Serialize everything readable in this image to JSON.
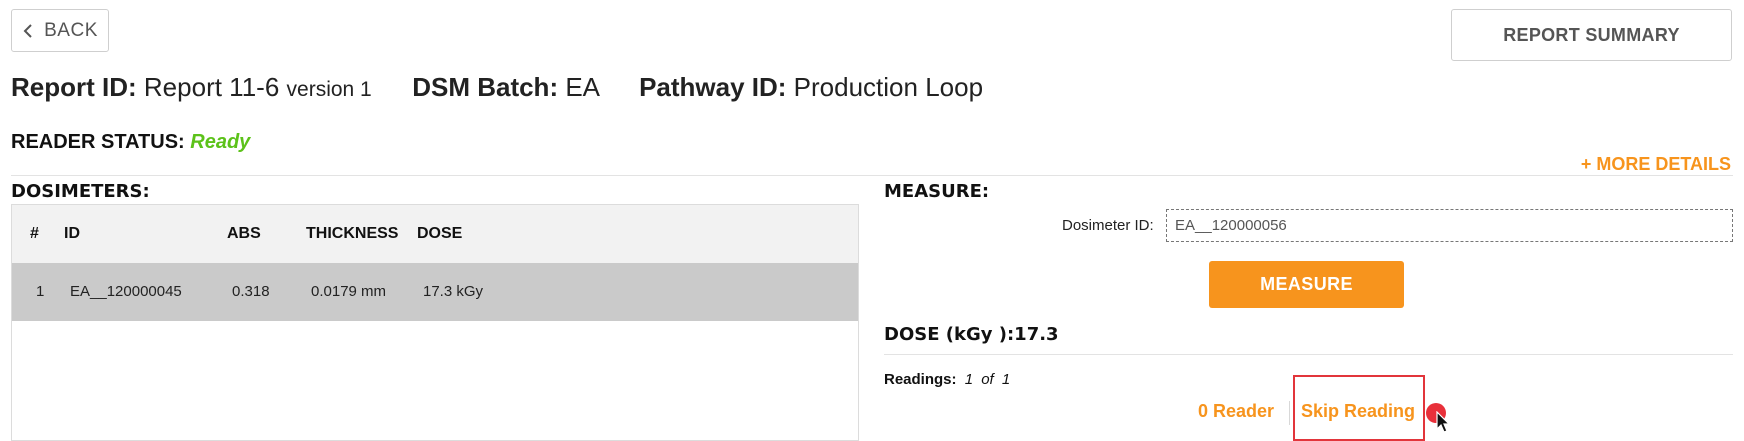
{
  "header": {
    "back_label": "BACK",
    "summary_label": "REPORT SUMMARY"
  },
  "report": {
    "report_id_label": "Report ID:",
    "report_id_value": "Report 11-6",
    "report_version": "version 1",
    "batch_label": "DSM Batch:",
    "batch_value": "EA",
    "pathway_label": "Pathway ID:",
    "pathway_value": "Production Loop"
  },
  "status": {
    "label": "READER STATUS:",
    "value": "Ready",
    "value_color": "#5cc21a"
  },
  "more_details": "+ MORE DETAILS",
  "dosimeters": {
    "title": "DOSIMETERS:",
    "columns": [
      "#",
      "ID",
      "ABS",
      "THICKNESS",
      "DOSE"
    ],
    "rows": [
      {
        "num": "1",
        "id": "EA__120000045",
        "abs": "0.318",
        "thickness": "0.0179 mm",
        "dose": "17.3 kGy"
      }
    ]
  },
  "measure": {
    "title": "MEASURE:",
    "dosimeter_id_label": "Dosimeter ID:",
    "dosimeter_id_value": "EA__120000056",
    "button_label": "MEASURE",
    "accent_color": "#f7941d"
  },
  "dose": {
    "label": "DOSE (kGy ):",
    "value": "17.3"
  },
  "readings": {
    "label": "Readings:",
    "current": "1",
    "of_label": "of",
    "total": "1"
  },
  "actions": {
    "reader_label": "0 Reader",
    "skip_label": "Skip Reading",
    "highlight_color": "#e2353b"
  }
}
